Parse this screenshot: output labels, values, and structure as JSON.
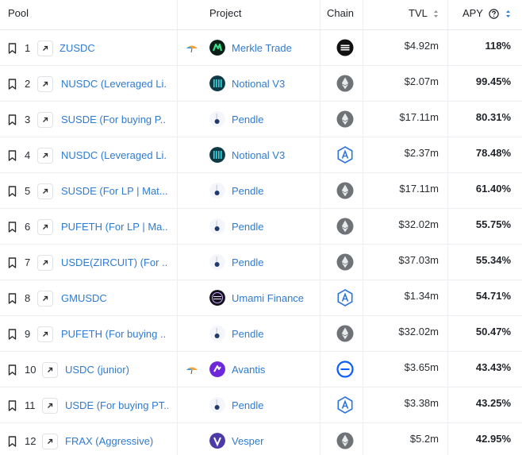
{
  "header": {
    "pool": "Pool",
    "project": "Project",
    "chain": "Chain",
    "tvl": "TVL",
    "apy": "APY",
    "help_icon": "question-circle-icon",
    "sort_icon": "sort-arrows-icon"
  },
  "colors": {
    "link": "#2f7bd1",
    "border": "#eceef1",
    "apy_text": "#1f2328"
  },
  "rows": [
    {
      "rank": "1",
      "pool": "ZUSDC",
      "umbrella": true,
      "project": "Merkle Trade",
      "project_logo": "merkle-logo",
      "chain": "ethena-chain-icon",
      "tvl": "$4.92m",
      "apy": "118%"
    },
    {
      "rank": "2",
      "pool": "NUSDC (Leveraged Li.",
      "umbrella": false,
      "project": "Notional V3",
      "project_logo": "notional-logo",
      "chain": "ethereum-chain-icon",
      "tvl": "$2.07m",
      "apy": "99.45%"
    },
    {
      "rank": "3",
      "pool": "SUSDE (For buying P..",
      "umbrella": false,
      "project": "Pendle",
      "project_logo": "pendle-logo",
      "chain": "ethereum-chain-icon",
      "tvl": "$17.11m",
      "apy": "80.31%"
    },
    {
      "rank": "4",
      "pool": "NUSDC (Leveraged Li.",
      "umbrella": false,
      "project": "Notional V3",
      "project_logo": "notional-logo",
      "chain": "arbitrum-chain-icon",
      "tvl": "$2.37m",
      "apy": "78.48%"
    },
    {
      "rank": "5",
      "pool": "SUSDE (For LP | Mat...",
      "umbrella": false,
      "project": "Pendle",
      "project_logo": "pendle-logo",
      "chain": "ethereum-chain-icon",
      "tvl": "$17.11m",
      "apy": "61.40%"
    },
    {
      "rank": "6",
      "pool": "PUFETH (For LP | Ma..",
      "umbrella": false,
      "project": "Pendle",
      "project_logo": "pendle-logo",
      "chain": "ethereum-chain-icon",
      "tvl": "$32.02m",
      "apy": "55.75%"
    },
    {
      "rank": "7",
      "pool": "USDE(ZIRCUIT) (For ...",
      "umbrella": false,
      "project": "Pendle",
      "project_logo": "pendle-logo",
      "chain": "ethereum-chain-icon",
      "tvl": "$37.03m",
      "apy": "55.34%"
    },
    {
      "rank": "8",
      "pool": "GMUSDC",
      "umbrella": false,
      "project": "Umami Finance",
      "project_logo": "umami-logo",
      "chain": "arbitrum-chain-icon",
      "tvl": "$1.34m",
      "apy": "54.71%"
    },
    {
      "rank": "9",
      "pool": "PUFETH (For buying ..",
      "umbrella": false,
      "project": "Pendle",
      "project_logo": "pendle-logo",
      "chain": "ethereum-chain-icon",
      "tvl": "$32.02m",
      "apy": "50.47%"
    },
    {
      "rank": "10",
      "pool": "USDC (junior)",
      "umbrella": true,
      "project": "Avantis",
      "project_logo": "avantis-logo",
      "chain": "base-chain-icon",
      "tvl": "$3.65m",
      "apy": "43.43%"
    },
    {
      "rank": "11",
      "pool": "USDE (For buying PT..",
      "umbrella": false,
      "project": "Pendle",
      "project_logo": "pendle-logo",
      "chain": "arbitrum-chain-icon",
      "tvl": "$3.38m",
      "apy": "43.25%"
    },
    {
      "rank": "12",
      "pool": "FRAX (Aggressive)",
      "umbrella": false,
      "project": "Vesper",
      "project_logo": "vesper-logo",
      "chain": "ethereum-chain-icon",
      "tvl": "$5.2m",
      "apy": "42.95%"
    }
  ]
}
